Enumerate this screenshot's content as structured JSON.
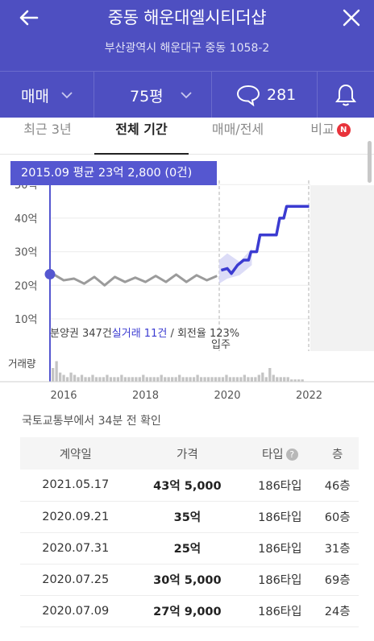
{
  "header": {
    "title": "중동 해운대엘시티더샵",
    "address": "부산광역시 해운대구 중동 1058-2"
  },
  "selectors": {
    "deal_type": "매매",
    "area": "75평",
    "comment_count": "281"
  },
  "tabs": [
    {
      "label": "최근 3년"
    },
    {
      "label": "전체 기간"
    },
    {
      "label": "매매/전세"
    },
    {
      "label": "비교",
      "badge": "N"
    }
  ],
  "tooltip": "2015.09 평균 23억 2,800 (0건)",
  "chart_data": {
    "type": "line",
    "title": "",
    "xlabel": "",
    "ylabel": "",
    "y_ticks": [
      "10억",
      "20억",
      "30억",
      "40억",
      "50억"
    ],
    "x_ticks": [
      "2016",
      "2018",
      "2020",
      "2022"
    ],
    "ylim": [
      10,
      50
    ],
    "xlim": [
      2015.7,
      2023.4
    ],
    "series": [
      {
        "name": "분양권",
        "color": "#9b9b9b",
        "x": [
          2015.75,
          2016.0,
          2016.25,
          2016.5,
          2016.75,
          2017.0,
          2017.25,
          2017.5,
          2017.75,
          2018.0,
          2018.25,
          2018.5,
          2018.75,
          2019.0,
          2019.25,
          2019.5,
          2019.75
        ],
        "y": [
          23.3,
          21.5,
          22.0,
          20.5,
          22.5,
          20.0,
          22.5,
          21.0,
          22.3,
          21.0,
          22.8,
          21.0,
          23.2,
          21.0,
          23.0,
          21.5,
          22.8
        ]
      },
      {
        "name": "실거래",
        "color": "#3b3bd1",
        "x": [
          2019.85,
          2020.0,
          2020.1,
          2020.25,
          2020.4,
          2020.52,
          2020.58,
          2020.72,
          2020.8,
          2021.2,
          2021.28,
          2021.38,
          2021.45,
          2022.0
        ],
        "y": [
          24.5,
          25.0,
          23.5,
          26.0,
          27.5,
          27.5,
          30.0,
          30.0,
          35.0,
          35.0,
          40.0,
          40.0,
          43.5,
          43.5
        ]
      }
    ],
    "uncertainty_band": {
      "x": [
        2019.8,
        2020.0,
        2020.3,
        2020.6
      ],
      "low": [
        20.5,
        22.0,
        23.0,
        26.0
      ],
      "high": [
        27.5,
        29.5,
        27.0,
        31.0
      ]
    },
    "move_in_label": "입주",
    "volume_label": "거래량",
    "volume": [
      6,
      9,
      4,
      3,
      2,
      4,
      3,
      2,
      3,
      2,
      2,
      3,
      2,
      2,
      2,
      3,
      2,
      2,
      2,
      3,
      2,
      2,
      2,
      2,
      2,
      3,
      2,
      2,
      2,
      2,
      3,
      2,
      2,
      2,
      2,
      3,
      2,
      2,
      2,
      2,
      3,
      2,
      2,
      2,
      2,
      2,
      2,
      2,
      3,
      2,
      2,
      2,
      2,
      3,
      2,
      2,
      2,
      3,
      4,
      2,
      6,
      3,
      2,
      2,
      2,
      2,
      1,
      1,
      1,
      1
    ],
    "volume_max": 12,
    "stats": {
      "prefix": "분양권 347건",
      "highlight": "실거래 11건",
      "suffix": " / 회전율 123%"
    }
  },
  "update_note": "국토교통부에서 34분 전 확인",
  "table": {
    "headers": [
      "계약일",
      "가격",
      "타입",
      "층"
    ],
    "rows": [
      {
        "date": "2021.05.17",
        "price": "43억 5,000",
        "type": "186타입",
        "floor": "46층"
      },
      {
        "date": "2020.09.21",
        "price": "35억",
        "type": "186타입",
        "floor": "60층"
      },
      {
        "date": "2020.07.31",
        "price": "25억",
        "type": "186타입",
        "floor": "31층"
      },
      {
        "date": "2020.07.25",
        "price": "30억 5,000",
        "type": "186타입",
        "floor": "69층"
      },
      {
        "date": "2020.07.09",
        "price": "27억 9,000",
        "type": "186타입",
        "floor": "24층"
      }
    ]
  }
}
